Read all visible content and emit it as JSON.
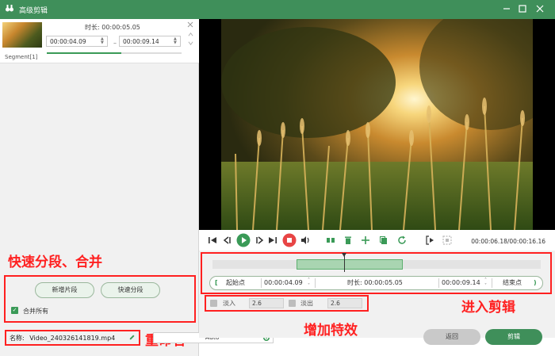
{
  "window": {
    "title": "高级剪辑"
  },
  "segment": {
    "label": "Segment[1]",
    "duration_label": "时长: 00:00:05.05",
    "start": "00:00:04.09",
    "separator": "–",
    "end": "00:00:09.14",
    "progress": 0.55
  },
  "left_panel": {
    "new_segment_button": "新增片段",
    "quick_split_button": "快速分段",
    "merge_all_label": "合并所有",
    "merge_all_checked": true,
    "name_label": "名称:",
    "name_value": "Video_240326141819.mp4",
    "output_value": "Auto"
  },
  "annotations": {
    "quick": "快速分段、合并",
    "rename": "重命名",
    "effects": "增加特效",
    "enter": "进入剪辑"
  },
  "player": {
    "timecode": "00:00:06.18/00:00:16.16"
  },
  "trim": {
    "start_button": "起始点",
    "start_value": "00:00:04.09",
    "duration_label": "时长: 00:00:05.05",
    "end_value": "00:00:09.14",
    "end_button": "结束点"
  },
  "effects": {
    "fade_in_label": "淡入",
    "fade_in_value": "2.6",
    "fade_out_label": "淡出",
    "fade_out_value": "2.6"
  },
  "buttons": {
    "back": "返回",
    "cut": "剪辑"
  },
  "colors": {
    "accent": "#3f8f5a",
    "annotation": "#ff2020"
  }
}
